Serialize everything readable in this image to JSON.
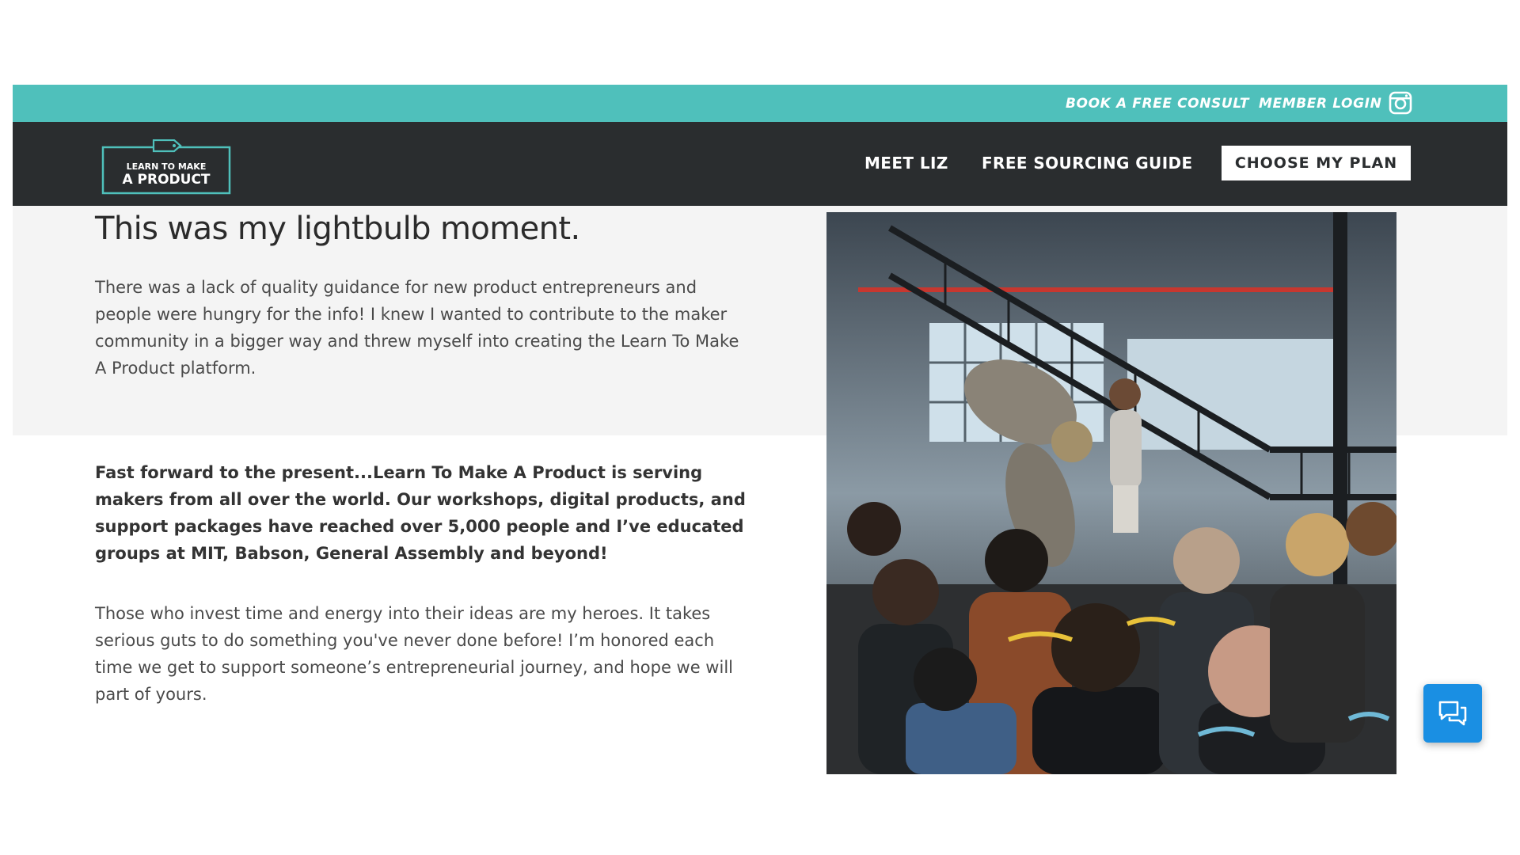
{
  "utility": {
    "consult_label": "BOOK A FREE CONSULT",
    "login_label": "MEMBER LOGIN",
    "social_icon": "instagram-icon"
  },
  "nav": {
    "logo_line1": "LEARN TO MAKE",
    "logo_line2": "A PRODUCT",
    "meet_label": "MEET LIZ",
    "guide_label": "FREE SOURCING GUIDE",
    "plan_label": "CHOOSE MY PLAN"
  },
  "content": {
    "heading": "This was my lightbulb moment.",
    "paragraph1": "There was a lack of quality guidance for new product entrepreneurs and people were hungry for the info! I knew I wanted to contribute to the maker community in a bigger way and threw myself into creating the Learn To Make A Product platform.",
    "paragraph2": "Fast forward to the present...Learn To Make A Product is serving makers from all over the world. Our workshops, digital products, and support packages have reached over 5,000 people and I’ve educated groups at MIT, Babson, General Assembly and beyond!",
    "paragraph3": "Those who invest time and energy into their ideas are my heroes. It takes serious guts to do something you've never done before! I’m honored each time we get to support someone’s entrepreneurial journey, and hope we will part of yours."
  },
  "colors": {
    "teal": "#4fc0bb",
    "nav_dark": "#2a2d2f",
    "chat_blue": "#1a8fe3"
  },
  "chat": {
    "icon": "chat-bubbles-icon"
  }
}
